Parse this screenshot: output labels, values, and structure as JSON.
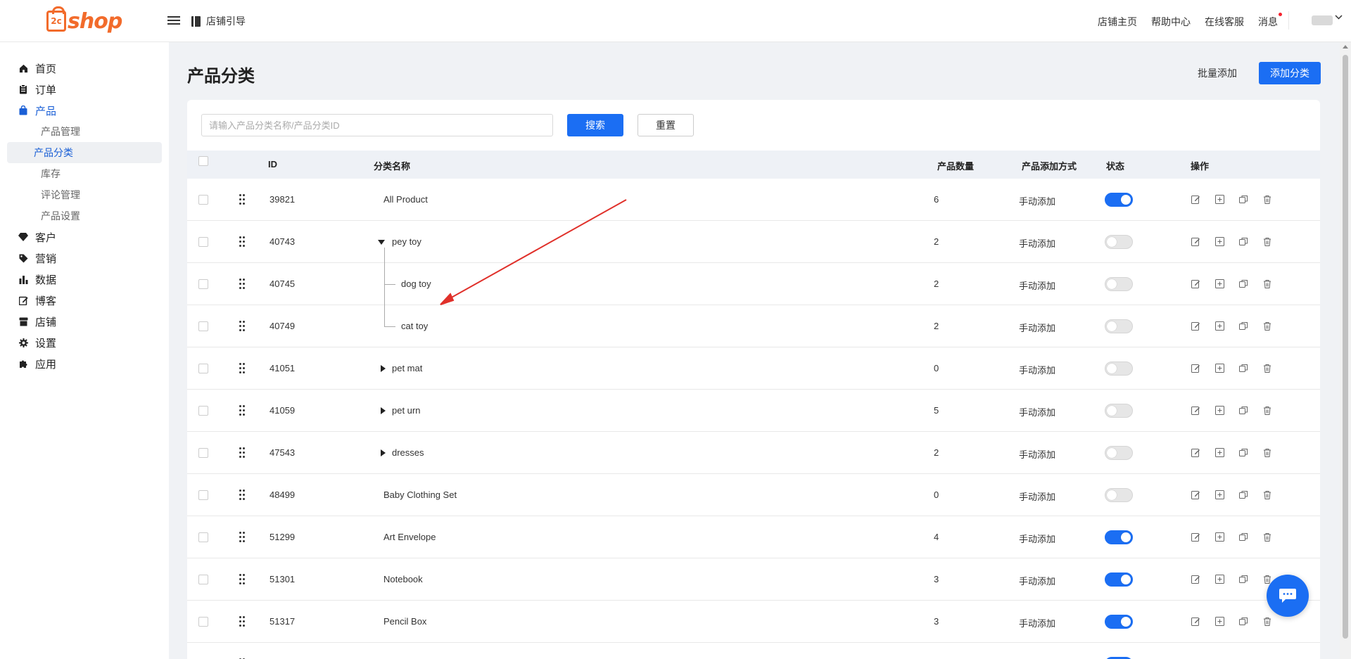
{
  "app": {
    "logo_text": "shop",
    "logo_mark": "2c"
  },
  "header": {
    "guide_label": "店铺引导",
    "nav": [
      "店铺主页",
      "帮助中心",
      "在线客服",
      "消息"
    ]
  },
  "sidebar": {
    "items": [
      {
        "label": "首页",
        "icon": "home-icon"
      },
      {
        "label": "订单",
        "icon": "clipboard-icon"
      },
      {
        "label": "产品",
        "icon": "bag-icon",
        "active": true
      },
      {
        "label": "客户",
        "icon": "diamond-icon"
      },
      {
        "label": "营销",
        "icon": "tag-icon"
      },
      {
        "label": "数据",
        "icon": "bar-chart-icon"
      },
      {
        "label": "博客",
        "icon": "edit-icon"
      },
      {
        "label": "店铺",
        "icon": "store-icon"
      },
      {
        "label": "设置",
        "icon": "gear-icon"
      },
      {
        "label": "应用",
        "icon": "puzzle-icon"
      }
    ],
    "product_sub": [
      "产品管理",
      "产品分类",
      "库存",
      "评论管理",
      "产品设置"
    ]
  },
  "page": {
    "title": "产品分类",
    "batch_add": "批量添加",
    "add_category": "添加分类"
  },
  "search": {
    "placeholder": "请输入产品分类名称/产品分类ID",
    "search_label": "搜索",
    "reset_label": "重置"
  },
  "table": {
    "headers": {
      "id": "ID",
      "name": "分类名称",
      "count": "产品数量",
      "method": "产品添加方式",
      "status": "状态",
      "actions": "操作"
    },
    "rows": [
      {
        "id": "39821",
        "name": "All Product",
        "count": "6",
        "method": "手动添加",
        "enabled": true,
        "tree": "none"
      },
      {
        "id": "40743",
        "name": "pey toy",
        "count": "2",
        "method": "手动添加",
        "enabled": false,
        "tree": "expanded"
      },
      {
        "id": "40745",
        "name": "dog toy",
        "count": "2",
        "method": "手动添加",
        "enabled": false,
        "tree": "child"
      },
      {
        "id": "40749",
        "name": "cat toy",
        "count": "2",
        "method": "手动添加",
        "enabled": false,
        "tree": "child-last"
      },
      {
        "id": "41051",
        "name": "pet mat",
        "count": "0",
        "method": "手动添加",
        "enabled": false,
        "tree": "collapsed"
      },
      {
        "id": "41059",
        "name": "pet urn",
        "count": "5",
        "method": "手动添加",
        "enabled": false,
        "tree": "collapsed"
      },
      {
        "id": "47543",
        "name": "dresses",
        "count": "2",
        "method": "手动添加",
        "enabled": false,
        "tree": "collapsed"
      },
      {
        "id": "48499",
        "name": "Baby Clothing Set",
        "count": "0",
        "method": "手动添加",
        "enabled": false,
        "tree": "none"
      },
      {
        "id": "51299",
        "name": "Art Envelope",
        "count": "4",
        "method": "手动添加",
        "enabled": true,
        "tree": "none"
      },
      {
        "id": "51301",
        "name": "Notebook",
        "count": "3",
        "method": "手动添加",
        "enabled": true,
        "tree": "none"
      },
      {
        "id": "51317",
        "name": "Pencil Box",
        "count": "3",
        "method": "手动添加",
        "enabled": true,
        "tree": "none"
      },
      {
        "id": "",
        "name": "",
        "count": "",
        "method": "",
        "enabled": true,
        "tree": "none"
      }
    ]
  },
  "colors": {
    "primary": "#1b6ef3",
    "brand": "#f26b2b",
    "annotation_arrow": "#e0302a"
  }
}
